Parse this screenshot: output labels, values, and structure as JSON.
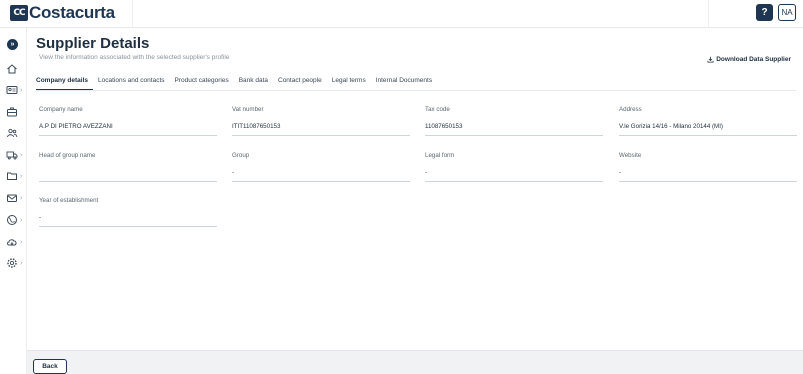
{
  "header": {
    "logo_mark": "CC",
    "logo_text": "Costacurta",
    "help_label": "?",
    "user_initials": "NA"
  },
  "sidebar": {
    "items": [
      {
        "icon": "home-icon",
        "has_submenu": false
      },
      {
        "icon": "id-card-icon",
        "has_submenu": true
      },
      {
        "icon": "briefcase-icon",
        "has_submenu": false
      },
      {
        "icon": "users-icon",
        "has_submenu": false
      },
      {
        "icon": "truck-icon",
        "has_submenu": true
      },
      {
        "icon": "folder-icon",
        "has_submenu": true
      },
      {
        "icon": "mail-icon",
        "has_submenu": true
      },
      {
        "icon": "globe-icon",
        "has_submenu": true
      },
      {
        "icon": "cloud-download-icon",
        "has_submenu": true
      },
      {
        "icon": "settings-icon",
        "has_submenu": true
      }
    ]
  },
  "page": {
    "title": "Supplier Details",
    "subtitle": "View the information associated with the selected supplier's profile",
    "download_label": "Download Data Supplier"
  },
  "tabs": [
    {
      "label": "Company details",
      "active": true
    },
    {
      "label": "Locations and contacts",
      "active": false
    },
    {
      "label": "Product categories",
      "active": false
    },
    {
      "label": "Bank data",
      "active": false
    },
    {
      "label": "Contact people",
      "active": false
    },
    {
      "label": "Legal terms",
      "active": false
    },
    {
      "label": "Internal Documents",
      "active": false
    }
  ],
  "fields": {
    "company_name": {
      "label": "Company name",
      "value": "A.P DI PIETRO AVEZZANI"
    },
    "vat_number": {
      "label": "Vat number",
      "value": "ITIT11087650153"
    },
    "tax_code": {
      "label": "Tax code",
      "value": "11087650153"
    },
    "address": {
      "label": "Address",
      "value": "V.le Gorizia 14/16 - Milano 20144 (MI)"
    },
    "head_of_group": {
      "label": "Head of group name",
      "value": ""
    },
    "group": {
      "label": "Group",
      "value": "-"
    },
    "legal_form": {
      "label": "Legal form",
      "value": "-"
    },
    "website": {
      "label": "Website",
      "value": "-"
    },
    "year_established": {
      "label": "Year of establishment",
      "value": "-"
    }
  },
  "footer": {
    "back_label": "Back"
  },
  "colors": {
    "primary": "#1f3652",
    "border": "#cfd4d9"
  }
}
